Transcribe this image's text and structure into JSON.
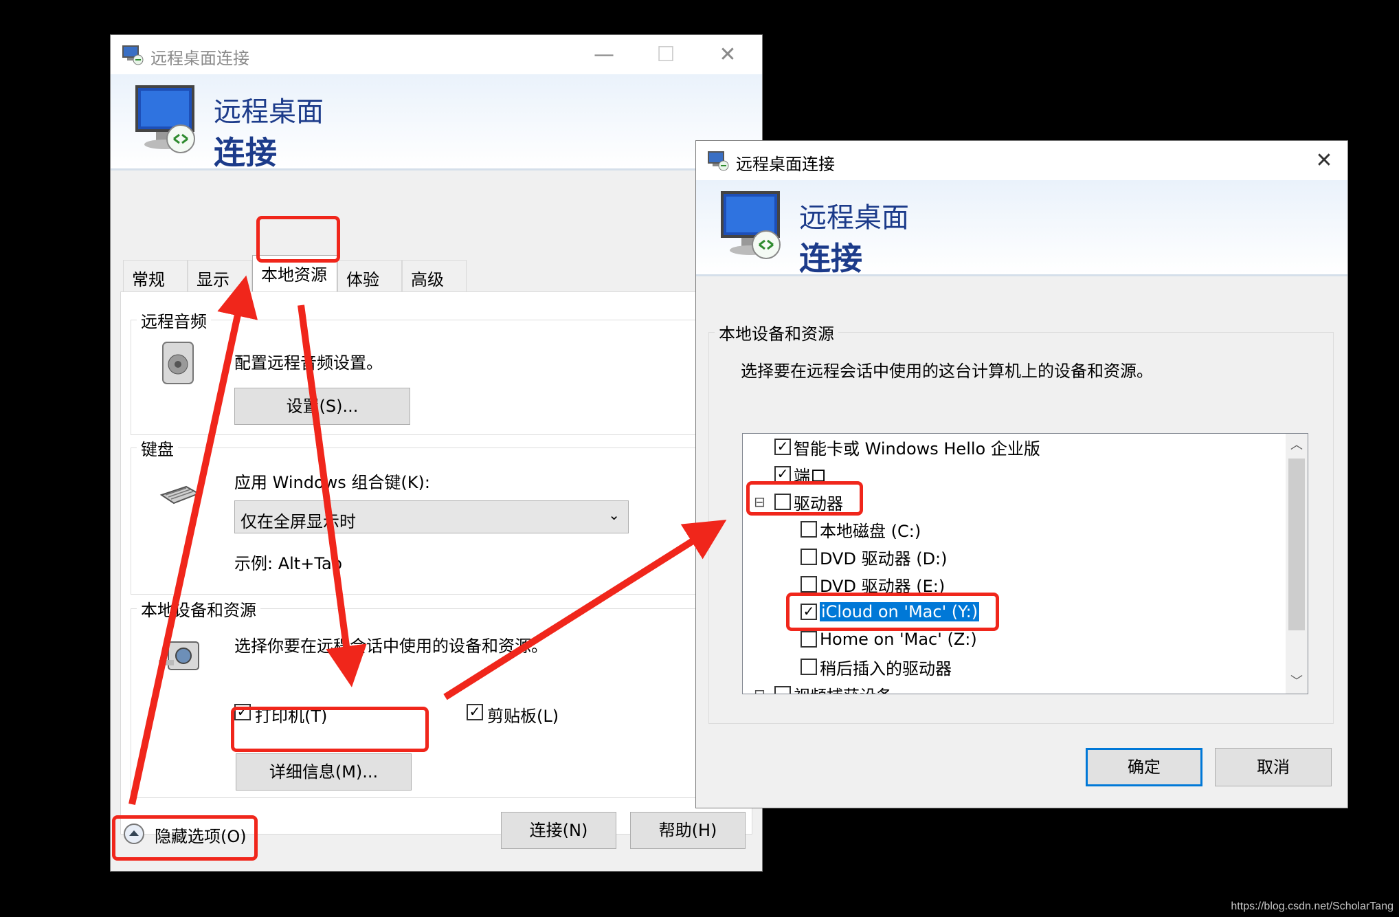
{
  "window_left": {
    "title": "远程桌面连接",
    "caption": {
      "minimize": "—",
      "maximize": "☐",
      "close": "✕"
    },
    "banner": {
      "line1": "远程桌面",
      "line2": "连接"
    },
    "tabs": [
      "常规",
      "显示",
      "本地资源",
      "体验",
      "高级"
    ],
    "active_tab": "本地资源",
    "audio": {
      "group_title": "远程音频",
      "description": "配置远程音频设置。",
      "settings_button": "设置(S)..."
    },
    "keyboard": {
      "group_title": "键盘",
      "label": "应用 Windows 组合键(K):",
      "selected": "仅在全屏显示时",
      "example": "示例: Alt+Tab"
    },
    "local_devices": {
      "group_title": "本地设备和资源",
      "description": "选择你要在远程会话中使用的设备和资源。",
      "printer": {
        "label": "打印机(T)",
        "checked": true
      },
      "clipboard": {
        "label": "剪贴板(L)",
        "checked": true
      },
      "details_button": "详细信息(M)..."
    },
    "hide_options": "隐藏选项(O)",
    "connect_button": "连接(N)",
    "help_button": "帮助(H)"
  },
  "window_right": {
    "title": "远程桌面连接",
    "caption": {
      "close": "✕"
    },
    "banner": {
      "line1": "远程桌面",
      "line2": "连接"
    },
    "group_title": "本地设备和资源",
    "description": "选择要在远程会话中使用的这台计算机上的设备和资源。",
    "tree": [
      {
        "label": "智能卡或 Windows Hello 企业版",
        "checked": true,
        "level": 0
      },
      {
        "label": "端口",
        "checked": true,
        "level": 0
      },
      {
        "label": "驱动器",
        "checked": false,
        "level": 0,
        "expander": "⊟"
      },
      {
        "label": "本地磁盘 (C:)",
        "checked": false,
        "level": 1
      },
      {
        "label": "DVD 驱动器 (D:)",
        "checked": false,
        "level": 1
      },
      {
        "label": "DVD 驱动器 (E:)",
        "checked": false,
        "level": 1
      },
      {
        "label": "iCloud on 'Mac' (Y:)",
        "checked": true,
        "level": 1,
        "selected": true
      },
      {
        "label": "Home on 'Mac' (Z:)",
        "checked": false,
        "level": 1
      },
      {
        "label": "稍后插入的驱动器",
        "checked": false,
        "level": 1
      },
      {
        "label": "视频捕获设备",
        "checked": false,
        "level": 0,
        "expander": "⊟"
      }
    ],
    "ok_button": "确定",
    "cancel_button": "取消"
  },
  "watermark": "https://blog.csdn.net/ScholarTang",
  "annotation_color": "#f0261b"
}
